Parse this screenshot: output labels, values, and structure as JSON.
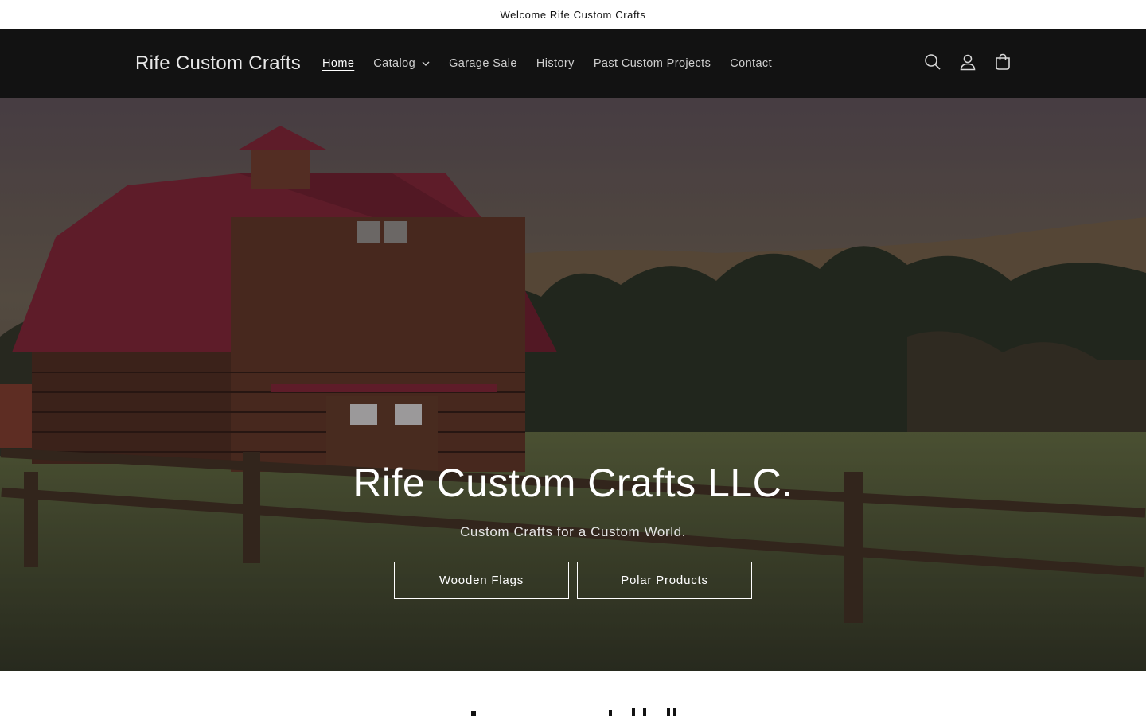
{
  "announcement": {
    "text": "Welcome Rife Custom Crafts"
  },
  "header": {
    "logo": "Rife Custom Crafts",
    "nav": [
      {
        "label": "Home",
        "active": true
      },
      {
        "label": "Catalog",
        "has_dropdown": true
      },
      {
        "label": "Garage Sale"
      },
      {
        "label": "History"
      },
      {
        "label": "Past Custom Projects"
      },
      {
        "label": "Contact"
      }
    ],
    "icons": [
      "search-icon",
      "account-icon",
      "cart-icon"
    ]
  },
  "hero": {
    "title": "Rife Custom Crafts LLC.",
    "subtitle": "Custom Crafts for a Custom World.",
    "buttons": [
      {
        "label": "Wooden Flags"
      },
      {
        "label": "Polar Products"
      }
    ]
  },
  "colors": {
    "header_bg": "#121212",
    "page_bg": "#ffffff",
    "barn_roof": "#7a2233",
    "barn_wood": "#4a2a1e"
  }
}
